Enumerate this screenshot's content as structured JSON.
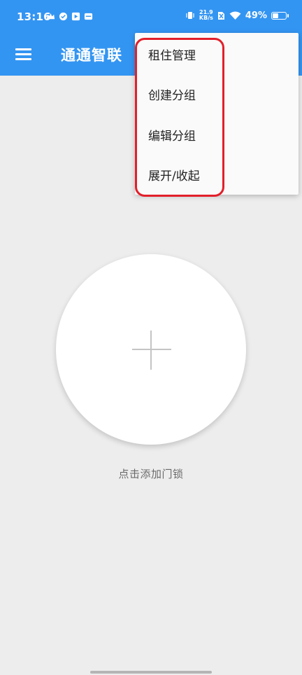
{
  "status_bar": {
    "time": "13:16",
    "net_speed_value": "21.9",
    "net_speed_unit": "KB/s",
    "battery_text": "49%",
    "battery_level": 0.49,
    "icons": [
      "crown-icon",
      "check-circle-icon",
      "play-icon",
      "app-icon",
      "vibrate-icon",
      "sim-off-icon",
      "wifi-icon",
      "battery-icon"
    ]
  },
  "app_bar": {
    "title": "通通智联",
    "menu_icon": "hamburger-menu-icon"
  },
  "dropdown_menu": {
    "items": [
      {
        "label": "租住管理"
      },
      {
        "label": "创建分组"
      },
      {
        "label": "编辑分组"
      },
      {
        "label": "展开/收起"
      }
    ]
  },
  "main": {
    "add_icon": "plus-icon",
    "hint": "点击添加门锁"
  },
  "colors": {
    "primary": "#3395f2",
    "background": "#ededed",
    "highlight": "#e21f2a"
  }
}
